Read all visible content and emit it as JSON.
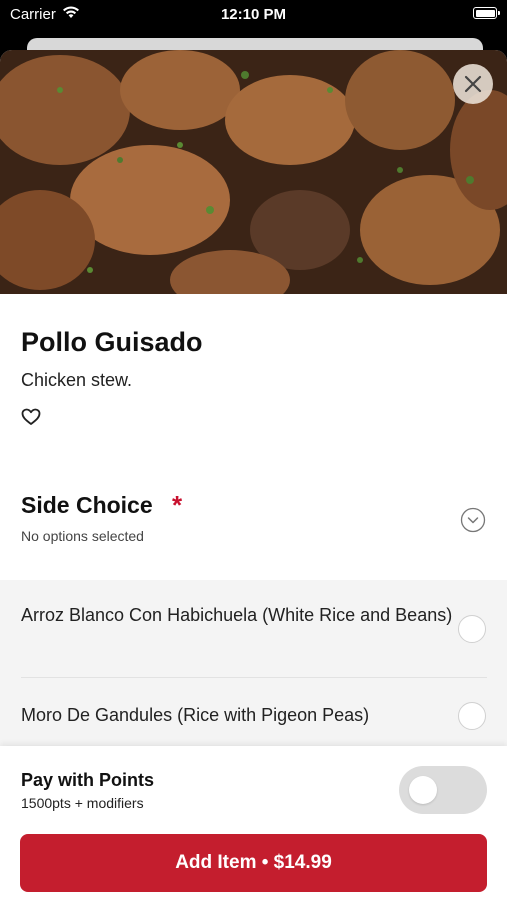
{
  "status_bar": {
    "carrier": "Carrier",
    "time": "12:10 PM"
  },
  "item": {
    "title": "Pollo Guisado",
    "description": "Chicken stew.",
    "image_name": "pollo-guisado-photo"
  },
  "side_choice": {
    "title": "Side Choice",
    "required_mark": "*",
    "subtitle": "No options selected",
    "options": [
      {
        "label": "Arroz Blanco Con Habichuela (White Rice and Beans)",
        "selected": false
      },
      {
        "label": "Moro De Gandules (Rice with Pigeon Peas)",
        "selected": false
      }
    ]
  },
  "points": {
    "title": "Pay with Points",
    "subtitle": "1500pts + modifiers",
    "enabled": false
  },
  "add_button": {
    "label": "Add Item • $14.99"
  },
  "colors": {
    "accent": "#c41e2e",
    "required": "#c8102e",
    "toggle_off": "#dcdcdc"
  }
}
